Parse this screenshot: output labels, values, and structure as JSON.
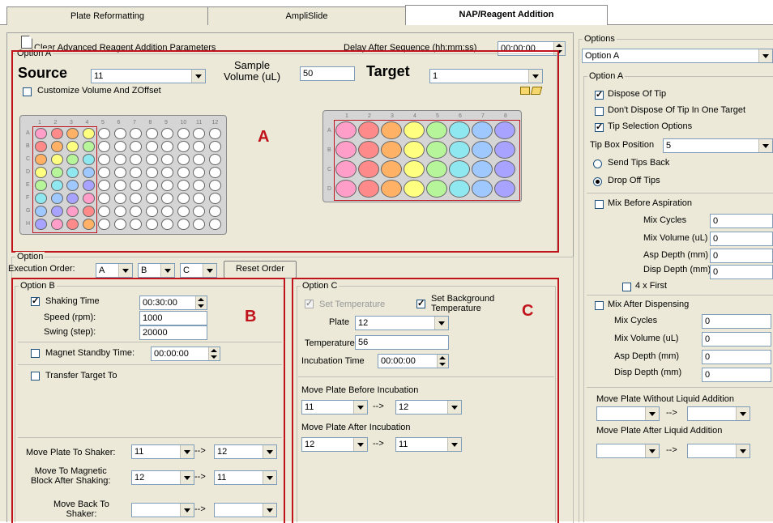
{
  "tabs": [
    {
      "label": "Plate Reformatting",
      "active": false
    },
    {
      "label": "AmpliSlide",
      "active": false
    },
    {
      "label": "NAP/Reagent Addition",
      "active": true
    }
  ],
  "top": {
    "clear_label": "Clear Advanced Reagent Addition Parameters",
    "delay_label": "Delay After Sequence (hh:mm:ss)",
    "delay_value": "00:00:00"
  },
  "option_a": {
    "legend": "Option A",
    "source_label": "Source",
    "source_value": "11",
    "sample_volume_label": "Sample\nVolume (uL)",
    "sample_volume_value": "50",
    "target_label": "Target",
    "target_value": "1",
    "customize_label": "Customize Volume And ZOffset",
    "annotation": "A",
    "plate96_cols": [
      "1",
      "2",
      "3",
      "4",
      "5",
      "6",
      "7",
      "8",
      "9",
      "10",
      "11",
      "12"
    ],
    "plate96_rows": [
      "A",
      "B",
      "C",
      "D",
      "E",
      "F",
      "G",
      "H"
    ],
    "plate32_cols": [
      "1",
      "2",
      "3",
      "4",
      "5",
      "6",
      "7",
      "8"
    ],
    "plate32_rows": [
      "A",
      "B",
      "C",
      "D"
    ],
    "well_colors": [
      "#ff9ec8",
      "#ff8a8a",
      "#ffb266",
      "#ffff80",
      "#b6f59a",
      "#8fe8f0",
      "#9fc8ff",
      "#a7a3ff"
    ]
  },
  "option_row": {
    "legend": "Option",
    "execution_order_label": "Execution Order:",
    "order_1": "A",
    "order_2": "B",
    "order_3": "C",
    "reset_label": "Reset Order"
  },
  "option_b": {
    "legend": "Option B",
    "annotation": "B",
    "shaking_time_label": "Shaking Time",
    "shaking_time_value": "00:30:00",
    "speed_label": "Speed (rpm):",
    "speed_value": "1000",
    "swing_label": "Swing (step):",
    "swing_value": "20000",
    "magnet_label": "Magnet Standby Time:",
    "magnet_value": "00:00:00",
    "transfer_label": "Transfer Target To",
    "move_shaker_label": "Move Plate To Shaker:",
    "move_shaker_from": "11",
    "move_shaker_to": "12",
    "move_magnetic_label": "Move To Magnetic\nBlock After Shaking:",
    "move_magnetic_from": "12",
    "move_magnetic_to": "11",
    "move_back_label": "Move Back To\nShaker:",
    "arrow": "-->"
  },
  "option_c": {
    "legend": "Option C",
    "annotation": "C",
    "set_temp_label": "Set Temperature",
    "set_bg_temp_label": "Set Background\nTemperature",
    "plate_label": "Plate",
    "plate_value": "12",
    "temperature_label": "Temperature",
    "temperature_value": "56",
    "incubation_label": "Incubation Time",
    "incubation_value": "00:00:00",
    "move_before_label": "Move Plate Before Incubation",
    "move_before_from": "11",
    "move_before_to": "12",
    "move_after_label": "Move Plate After Incubation",
    "move_after_from": "12",
    "move_after_to": "11",
    "arrow": "-->"
  },
  "options_panel": {
    "legend": "Options",
    "selected": "Option A",
    "group_legend": "Option A",
    "dispose_tip": "Dispose Of Tip",
    "dont_dispose": "Don't Dispose Of Tip In One Target",
    "tip_selection": "Tip Selection Options",
    "tip_box_label": "Tip Box Position",
    "tip_box_value": "5",
    "send_tips_back": "Send Tips Back",
    "drop_off_tips": "Drop Off Tips",
    "mix_before": "Mix Before Aspiration",
    "mix_cycles": "Mix Cycles",
    "mix_cycles_value": "0",
    "mix_volume": "Mix Volume (uL)",
    "mix_volume_value": "0",
    "asp_depth": "Asp Depth (mm)",
    "asp_depth_value": "0",
    "disp_depth": "Disp Depth (mm)",
    "disp_depth_value": "0",
    "four_x_first": "4 x First",
    "mix_after": "Mix After Dispensing",
    "mix_cycles2": "Mix Cycles",
    "mix_cycles2_value": "0",
    "mix_volume2": "Mix Volume (uL)",
    "mix_volume2_value": "0",
    "asp_depth2": "Asp Depth (mm)",
    "asp_depth2_value": "0",
    "disp_depth2": "Disp Depth (mm)",
    "disp_depth2_value": "0",
    "move_without": "Move Plate Without Liquid Addition",
    "move_after_liquid": "Move Plate After Liquid Addition",
    "arrow": "-->"
  }
}
